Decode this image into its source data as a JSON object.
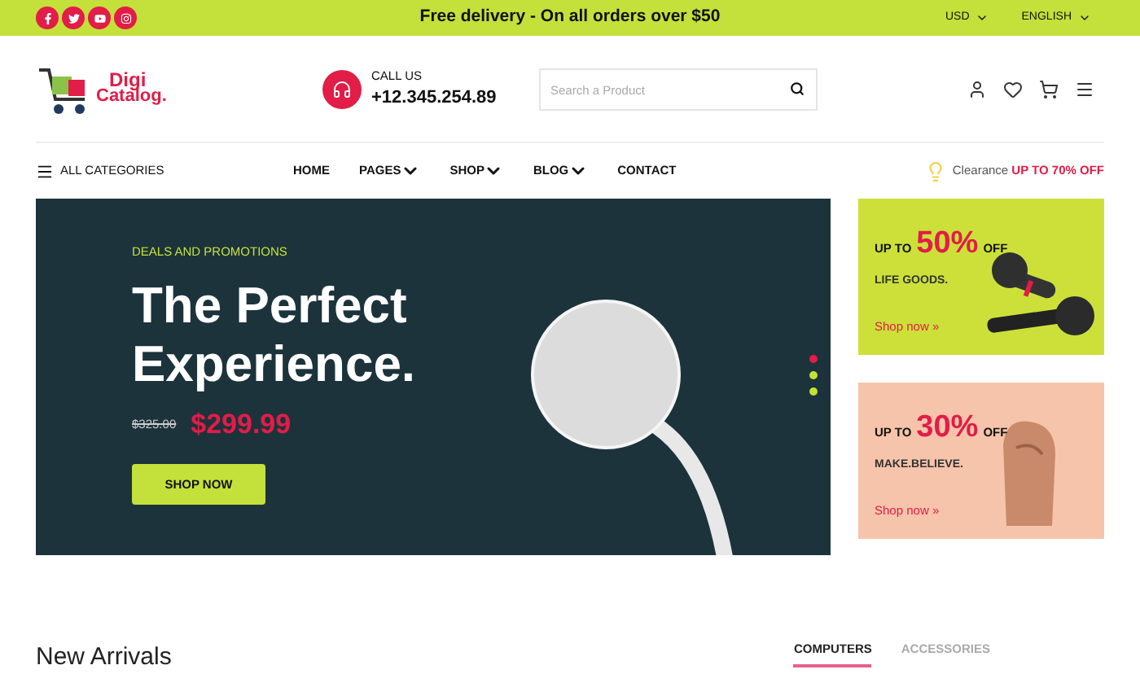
{
  "top_bar": {
    "socials": [
      {
        "kind": "facebook"
      },
      {
        "kind": "twitter"
      },
      {
        "kind": "youtube"
      },
      {
        "kind": "instagram"
      }
    ],
    "message": "Free delivery - On all orders over $50",
    "currency": "USD",
    "language": "ENGLISH"
  },
  "header": {
    "logo": {
      "line1": "Digi",
      "line2": "Catalog."
    },
    "call_label": "CALL US",
    "phone": "+12.345.254.89",
    "search": {
      "placeholder": "Search a Product"
    }
  },
  "nav": {
    "categories": "ALL CATEGORIES",
    "items": [
      {
        "label": "HOME",
        "dropdown": false
      },
      {
        "label": "PAGES",
        "dropdown": true
      },
      {
        "label": "SHOP",
        "dropdown": true
      },
      {
        "label": "BLOG",
        "dropdown": true
      },
      {
        "label": "CONTACT",
        "dropdown": false
      }
    ],
    "promo": {
      "label": "Clearance",
      "highlight": "UP TO 70% OFF"
    }
  },
  "hero": {
    "eyebrow": "DEALS AND PROMOTIONS",
    "title_line1": "The Perfect",
    "title_line2": "Experience.",
    "old_price": "$325.00",
    "price": "$299.99",
    "button": "SHOP NOW",
    "dots": [
      {
        "selected": true
      },
      {
        "selected": false
      },
      {
        "selected": false
      }
    ]
  },
  "banners": [
    {
      "kind": "mic",
      "prefix": "UP TO",
      "percent": "50%",
      "suffix": "OFF",
      "subtitle": "LIFE GOODS.",
      "link": "Shop now »"
    },
    {
      "kind": "hand",
      "prefix": "UP TO",
      "percent": "30%",
      "suffix": "OFF",
      "subtitle": "MAKE.BELIEVE.",
      "link": "Shop now »"
    }
  ],
  "new_arrivals": {
    "title": "New Arrivals",
    "tabs": [
      {
        "label": "COMPUTERS",
        "selected": true
      },
      {
        "label": "ACCESSORIES",
        "selected": false
      }
    ]
  }
}
